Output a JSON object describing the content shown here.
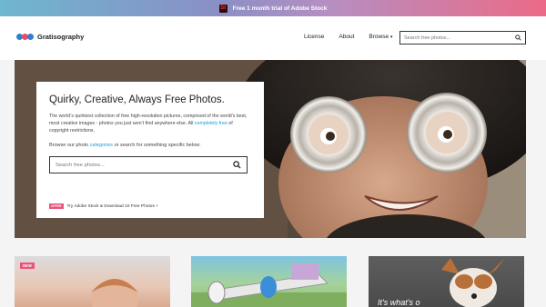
{
  "promo": {
    "icon": "adobe-stock-logo",
    "text": "Free 1 month trial of Adobe Stock"
  },
  "header": {
    "logo_text": "Gratisography",
    "logo_colors": [
      "#2f7fd0",
      "#e84c6b",
      "#2f7fd0"
    ],
    "nav": [
      "License",
      "About",
      "Browse"
    ],
    "browse_caret": "▾",
    "search_placeholder": "Search free photos..."
  },
  "hero": {
    "title": "Quirky, Creative, Always Free Photos.",
    "desc_part1": "The world’s quirkiest collection of free high-resolution pictures, comprised of the world’s best, most creative images - photos you just won’t find anywhere else. All",
    "desc_link": "completely free",
    "desc_part2": "of copyright restrictions.",
    "browse_part1": "Browse our photo",
    "browse_link": "categories",
    "browse_part2": "or search for something specific below:",
    "search_placeholder": "Search free photos...",
    "offer_badge": "OFFER",
    "offer_text": "Try Adobe Stock & Download 10 Free Photos +"
  },
  "tiles": [
    {
      "badge": "NEW"
    },
    {},
    {
      "caption": "It's what's o"
    }
  ],
  "colors": {
    "accent_link": "#1a9ad6",
    "badge_pink": "#e8557a"
  }
}
